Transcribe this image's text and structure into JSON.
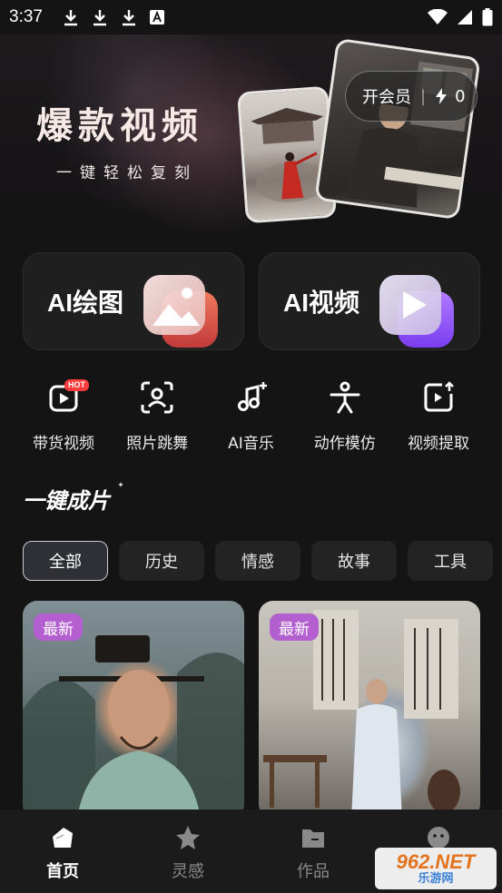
{
  "status_bar": {
    "time": "3:37"
  },
  "banner": {
    "title": "爆款视频",
    "subtitle": "一键轻松复刻",
    "vip_label": "开会员",
    "vip_separator": "|",
    "credits": "0"
  },
  "ai_cards": {
    "draw_label": "AI绘图",
    "video_label": "AI视频"
  },
  "tools": {
    "items": [
      {
        "label": "带货视频",
        "icon": "play-icon",
        "badge": "HOT"
      },
      {
        "label": "照片跳舞",
        "icon": "face-scan-icon"
      },
      {
        "label": "AI音乐",
        "icon": "music-sparkle-icon"
      },
      {
        "label": "动作模仿",
        "icon": "person-pose-icon"
      },
      {
        "label": "视频提取",
        "icon": "video-upload-icon"
      }
    ]
  },
  "section": {
    "title": "一键成片"
  },
  "tabs": {
    "items": [
      "全部",
      "历史",
      "情感",
      "故事",
      "工具"
    ],
    "active": "全部"
  },
  "cards": {
    "items": [
      {
        "badge": "最新"
      },
      {
        "badge": "最新"
      }
    ]
  },
  "bottom_nav": {
    "items": [
      {
        "label": "首页",
        "icon": "home-icon",
        "active": true
      },
      {
        "label": "灵感",
        "icon": "star-icon"
      },
      {
        "label": "作品",
        "icon": "folder-icon"
      },
      {
        "label": "",
        "icon": "smile-icon"
      }
    ]
  },
  "watermark": {
    "top": "962.NET",
    "bottom": "乐游网"
  },
  "colors": {
    "accent_badge": "#b45fcf",
    "hot_badge": "#ff3b3b",
    "background": "#141414"
  }
}
